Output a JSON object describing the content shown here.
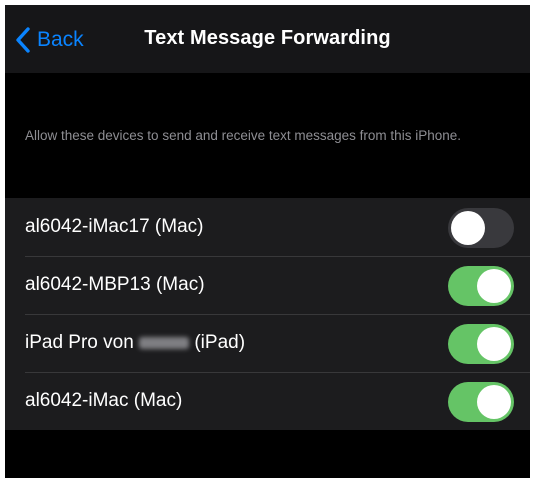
{
  "nav": {
    "back_label": "Back",
    "title": "Text Message Forwarding"
  },
  "caption": "Allow these devices to send and receive text messages from this iPhone.",
  "devices": [
    {
      "label": "al6042-iMac17 (Mac)",
      "enabled": false
    },
    {
      "label": "al6042-MBP13 (Mac)",
      "enabled": true
    },
    {
      "label_prefix": "iPad Pro von",
      "label_suffix": "(iPad)",
      "enabled": true
    },
    {
      "label": "al6042-iMac (Mac)",
      "enabled": true
    }
  ],
  "colors": {
    "accent": "#0a84ff",
    "toggle_on": "#65c466",
    "toggle_off": "#39393d",
    "background": "#000000",
    "cell": "#1c1c1e"
  },
  "icons": {
    "back": "chevron-left-icon"
  }
}
